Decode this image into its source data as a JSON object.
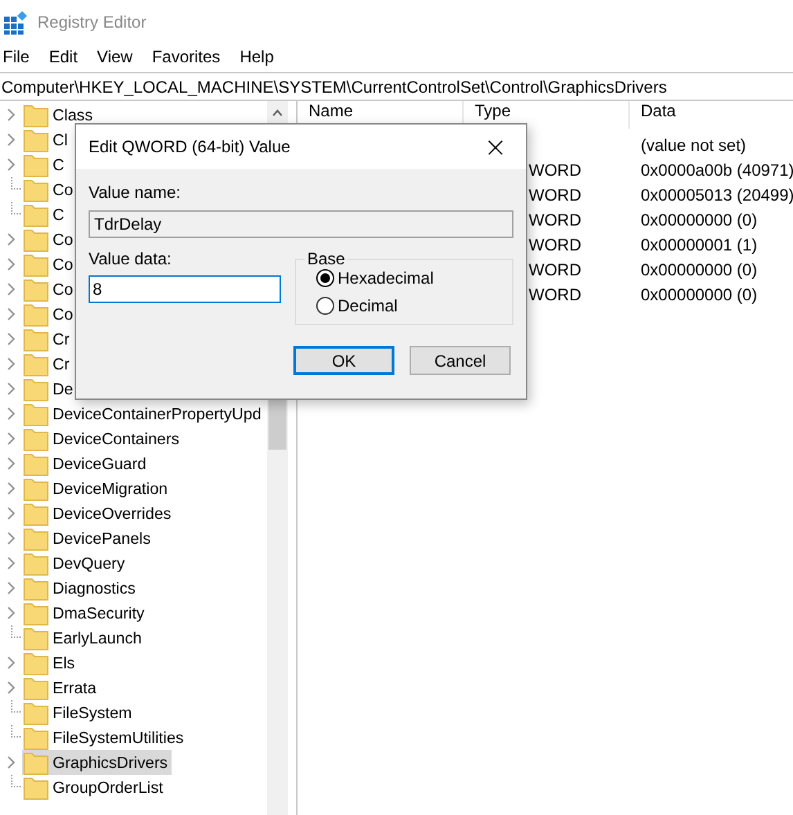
{
  "window": {
    "title": "Registry Editor"
  },
  "menu": [
    "File",
    "Edit",
    "View",
    "Favorites",
    "Help"
  ],
  "address": "Computer\\HKEY_LOCAL_MACHINE\\SYSTEM\\CurrentControlSet\\Control\\GraphicsDrivers",
  "tree": [
    {
      "label": "Class",
      "expandable": true,
      "selected": false
    },
    {
      "label": "Cl",
      "expandable": true,
      "selected": false
    },
    {
      "label": "C",
      "expandable": true,
      "selected": false
    },
    {
      "label": "Co",
      "expandable": false,
      "selected": false
    },
    {
      "label": "C",
      "expandable": false,
      "selected": false
    },
    {
      "label": "Co",
      "expandable": true,
      "selected": false
    },
    {
      "label": "Co",
      "expandable": true,
      "selected": false
    },
    {
      "label": "Co",
      "expandable": true,
      "selected": false
    },
    {
      "label": "Co",
      "expandable": true,
      "selected": false
    },
    {
      "label": "Cr",
      "expandable": true,
      "selected": false
    },
    {
      "label": "Cr",
      "expandable": true,
      "selected": false
    },
    {
      "label": "De",
      "expandable": true,
      "selected": false
    },
    {
      "label": "DeviceContainerPropertyUpd",
      "expandable": true,
      "selected": false
    },
    {
      "label": "DeviceContainers",
      "expandable": true,
      "selected": false
    },
    {
      "label": "DeviceGuard",
      "expandable": true,
      "selected": false
    },
    {
      "label": "DeviceMigration",
      "expandable": true,
      "selected": false
    },
    {
      "label": "DeviceOverrides",
      "expandable": true,
      "selected": false
    },
    {
      "label": "DevicePanels",
      "expandable": true,
      "selected": false
    },
    {
      "label": "DevQuery",
      "expandable": true,
      "selected": false
    },
    {
      "label": "Diagnostics",
      "expandable": true,
      "selected": false
    },
    {
      "label": "DmaSecurity",
      "expandable": true,
      "selected": false
    },
    {
      "label": "EarlyLaunch",
      "expandable": false,
      "selected": false
    },
    {
      "label": "Els",
      "expandable": true,
      "selected": false
    },
    {
      "label": "Errata",
      "expandable": true,
      "selected": false
    },
    {
      "label": "FileSystem",
      "expandable": false,
      "selected": false
    },
    {
      "label": "FileSystemUtilities",
      "expandable": false,
      "selected": false
    },
    {
      "label": "GraphicsDrivers",
      "expandable": true,
      "selected": true
    },
    {
      "label": "GroupOrderList",
      "expandable": false,
      "selected": false
    }
  ],
  "list": {
    "columns": [
      "Name",
      "Type",
      "Data"
    ],
    "rows": [
      {
        "data": "(value not set)"
      },
      {
        "type": "WORD",
        "data": "0x0000a00b (40971)"
      },
      {
        "type": "WORD",
        "data": "0x00005013 (20499)"
      },
      {
        "type": "WORD",
        "data": "0x00000000 (0)"
      },
      {
        "type": "WORD",
        "data": "0x00000001 (1)"
      },
      {
        "type": "WORD",
        "data": "0x00000000 (0)"
      },
      {
        "type": "WORD",
        "data": "0x00000000 (0)"
      }
    ]
  },
  "dialog": {
    "title": "Edit QWORD (64-bit) Value",
    "close": "×",
    "value_name_label": "Value name:",
    "value_name": "TdrDelay",
    "value_data_label": "Value data:",
    "value_data": "8",
    "base_label": "Base",
    "base_options": [
      {
        "label": "Hexadecimal",
        "selected": true
      },
      {
        "label": "Decimal",
        "selected": false
      }
    ],
    "buttons": [
      {
        "label": "OK",
        "default": true
      },
      {
        "label": "Cancel",
        "default": false
      }
    ]
  }
}
